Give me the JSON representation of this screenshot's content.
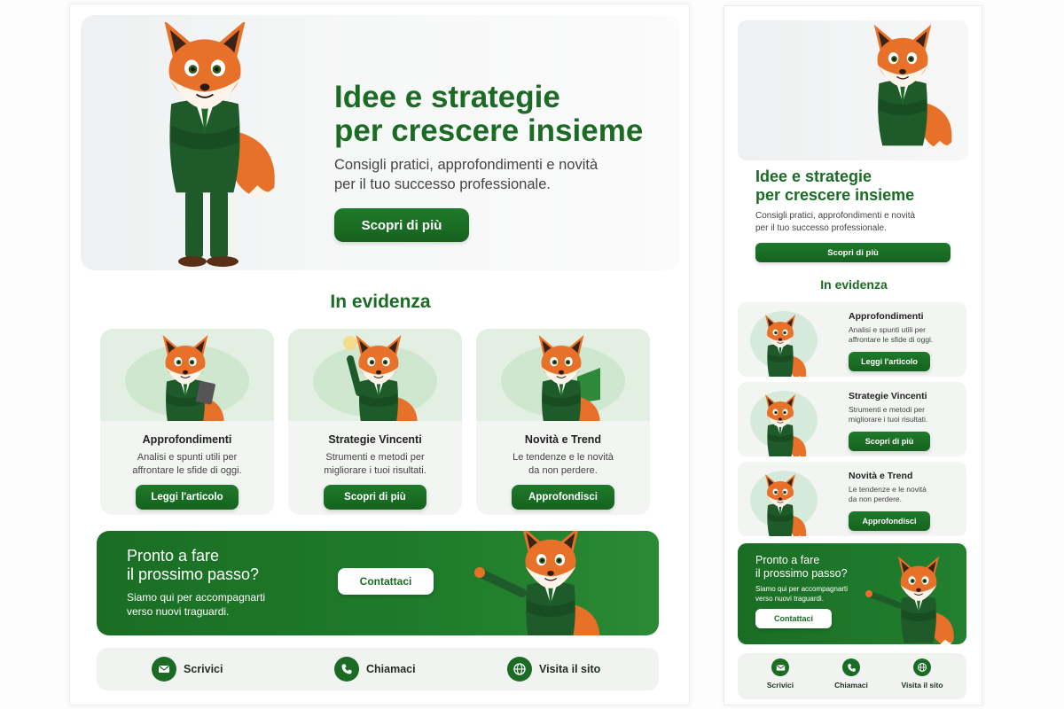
{
  "colors": {
    "brand_green": "#1b6b25",
    "fox_orange": "#e8712a",
    "suit_green": "#1f5a2a",
    "card_bg": "#f2f5f2"
  },
  "desktop": {
    "hero": {
      "title": "Idee e strategie\nper crescere insieme",
      "subtitle": "Consigli pratici, approfondimenti e novità\nper il tuo successo professionale.",
      "button": "Scopri di più",
      "image": "fox-mascot-arms-crossed"
    },
    "section_title": "In evidenza",
    "cards": [
      {
        "title": "Approfondimenti",
        "desc": "Analisi e spunti utili per\naffrontare le sfide di oggi.",
        "button": "Leggi l'articolo",
        "image": "fox-with-tablet"
      },
      {
        "title": "Strategie Vincenti",
        "desc": "Strumenti e metodi per\nmigliorare i tuoi risultati.",
        "button": "Scopri di più",
        "image": "fox-with-idea-lightbulb"
      },
      {
        "title": "Novità e Trend",
        "desc": "Le tendenze e le novità\nda non perdere.",
        "button": "Approfondisci",
        "image": "fox-with-chart"
      }
    ],
    "cta": {
      "title": "Pronto a fare\nil prossimo passo?",
      "subtitle": "Siamo qui per accompagnarti\nverso nuovi traguardi.",
      "button": "Contattaci",
      "image": "fox-presenting"
    },
    "contacts": [
      {
        "label": "Scrivici",
        "icon": "mail-icon"
      },
      {
        "label": "Chiamaci",
        "icon": "phone-icon"
      },
      {
        "label": "Visita il sito",
        "icon": "globe-icon"
      }
    ]
  },
  "mobile": {
    "hero": {
      "title": "Idee e strategie\nper crescere insieme",
      "subtitle": "Consigli pratici, approfondimenti e novità\nper il tuo successo professionale.",
      "button": "Scopri di più"
    },
    "section_title": "In evidenza",
    "cards": [
      {
        "title": "Approfondimenti",
        "desc": "Analisi e spunti utili per\naffrontare le sfide di oggi.",
        "button": "Leggi l'articolo"
      },
      {
        "title": "Strategie Vincenti",
        "desc": "Strumenti e metodi per\nmigliorare i tuoi risultati.",
        "button": "Scopri di più"
      },
      {
        "title": "Novità e Trend",
        "desc": "Le tendenze e le novità\nda non perdere.",
        "button": "Approfondisci"
      }
    ],
    "cta": {
      "title": "Pronto a fare\nil prossimo passo?",
      "subtitle": "Siamo qui per accompagnarti\nverso nuovi traguardi.",
      "button": "Contattaci"
    },
    "contacts": [
      {
        "label": "Scrivici",
        "icon": "mail-icon"
      },
      {
        "label": "Chiamaci",
        "icon": "phone-icon"
      },
      {
        "label": "Visita il sito",
        "icon": "globe-icon"
      }
    ]
  }
}
